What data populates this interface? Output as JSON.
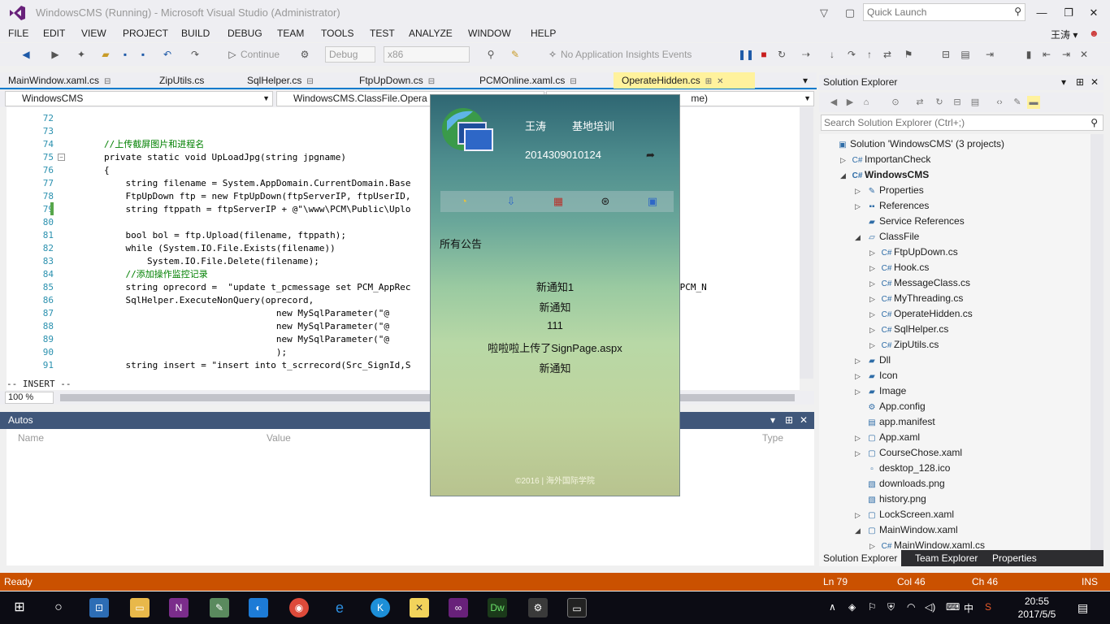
{
  "window": {
    "title": "WindowsCMS (Running) - Microsoft Visual Studio (Administrator)",
    "quick_launch_placeholder": "Quick Launch",
    "user": "王涛 ▾"
  },
  "menu": [
    "FILE",
    "EDIT",
    "VIEW",
    "PROJECT",
    "BUILD",
    "DEBUG",
    "TEAM",
    "TOOLS",
    "TEST",
    "ANALYZE",
    "WINDOW",
    "HELP"
  ],
  "toolbar": {
    "continue_label": "Continue",
    "config": "Debug",
    "platform": "x86",
    "insights": "No Application Insights Events"
  },
  "doc_tabs": [
    "MainWindow.xaml.cs",
    "ZipUtils.cs",
    "SqlHelper.cs",
    "FtpUpDown.cs",
    "PCMOnline.xaml.cs",
    "OperateHidden.cs"
  ],
  "nav": {
    "project": "WindowsCMS",
    "class": "WindowsCMS.ClassFile.Opera",
    "member": "me)"
  },
  "code": {
    "lines": [
      {
        "n": "72",
        "t": ""
      },
      {
        "n": "73",
        "t": ""
      },
      {
        "n": "74",
        "t": "//上传截屏图片和进程名"
      },
      {
        "n": "75",
        "t": "private static void UpLoadJpg(string jpgname)"
      },
      {
        "n": "76",
        "t": "{"
      },
      {
        "n": "77",
        "t": "    string filename = System.AppDomain.CurrentDomain.Base"
      },
      {
        "n": "78",
        "t": "    FtpUpDown ftp = new FtpUpDown(ftpServerIP, ftpUserID,"
      },
      {
        "n": "79",
        "t": "    string ftppath = ftpServerIP + @\"\\www\\PCM\\Public\\Uplo"
      },
      {
        "n": "80",
        "t": ""
      },
      {
        "n": "81",
        "t": "    bool bol = ftp.Upload(filename, ftppath);"
      },
      {
        "n": "82",
        "t": "    while (System.IO.File.Exists(filename))"
      },
      {
        "n": "83",
        "t": "        System.IO.File.Delete(filename);"
      },
      {
        "n": "84",
        "t": "    //添加操作监控记录"
      },
      {
        "n": "85",
        "t": "    string oprecord =  \"update t_pcmessage set PCM_AppRec                                  eenJpgsrc where PCM_N"
      },
      {
        "n": "86",
        "t": "    SqlHelper.ExecuteNonQuery(oprecord,"
      },
      {
        "n": "87",
        "t": "                                new MySqlParameter(\"@"
      },
      {
        "n": "88",
        "t": "                                new MySqlParameter(\"@"
      },
      {
        "n": "89",
        "t": "                                new MySqlParameter(\"@"
      },
      {
        "n": "90",
        "t": "                                );"
      },
      {
        "n": "91",
        "t": "    string insert = \"insert into t_scrrecord(Src_SignId,S                                          \";"
      }
    ],
    "insert_mode": "-- INSERT --",
    "zoom": "100 %"
  },
  "autos": {
    "title": "Autos",
    "col_name": "Name",
    "col_value": "Value",
    "col_type": "Type"
  },
  "solution_explorer": {
    "title": "Solution Explorer",
    "search_placeholder": "Search Solution Explorer (Ctrl+;)",
    "items": [
      {
        "label": "Solution 'WindowsCMS' (3 projects)",
        "icon": "solution-icon",
        "depth": 0,
        "exp": ""
      },
      {
        "label": "ImportanCheck",
        "icon": "csproj-icon",
        "depth": 1,
        "exp": "▷"
      },
      {
        "label": "WindowsCMS",
        "icon": "csproj-icon",
        "depth": 1,
        "exp": "◢",
        "bold": true
      },
      {
        "label": "Properties",
        "icon": "wrench-icon",
        "depth": 2,
        "exp": "▷"
      },
      {
        "label": "References",
        "icon": "references-icon",
        "depth": 2,
        "exp": "▷"
      },
      {
        "label": "Service References",
        "icon": "folder-icon",
        "depth": 2,
        "exp": ""
      },
      {
        "label": "ClassFile",
        "icon": "folder-open-icon",
        "depth": 2,
        "exp": "◢"
      },
      {
        "label": "FtpUpDown.cs",
        "icon": "cs-file-icon",
        "depth": 3,
        "exp": "▷"
      },
      {
        "label": "Hook.cs",
        "icon": "cs-file-icon",
        "depth": 3,
        "exp": "▷"
      },
      {
        "label": "MessageClass.cs",
        "icon": "cs-file-icon",
        "depth": 3,
        "exp": "▷"
      },
      {
        "label": "MyThreading.cs",
        "icon": "cs-file-icon",
        "depth": 3,
        "exp": "▷"
      },
      {
        "label": "OperateHidden.cs",
        "icon": "cs-file-icon",
        "depth": 3,
        "exp": "▷"
      },
      {
        "label": "SqlHelper.cs",
        "icon": "cs-file-icon",
        "depth": 3,
        "exp": "▷"
      },
      {
        "label": "ZipUtils.cs",
        "icon": "cs-file-icon",
        "depth": 3,
        "exp": "▷"
      },
      {
        "label": "Dll",
        "icon": "folder-icon",
        "depth": 2,
        "exp": "▷"
      },
      {
        "label": "Icon",
        "icon": "folder-icon",
        "depth": 2,
        "exp": "▷"
      },
      {
        "label": "Image",
        "icon": "folder-icon",
        "depth": 2,
        "exp": "▷"
      },
      {
        "label": "App.config",
        "icon": "config-file-icon",
        "depth": 2,
        "exp": ""
      },
      {
        "label": "app.manifest",
        "icon": "manifest-file-icon",
        "depth": 2,
        "exp": ""
      },
      {
        "label": "App.xaml",
        "icon": "xaml-file-icon",
        "depth": 2,
        "exp": "▷"
      },
      {
        "label": "CourseChose.xaml",
        "icon": "xaml-file-icon",
        "depth": 2,
        "exp": "▷"
      },
      {
        "label": "desktop_128.ico",
        "icon": "ico-file-icon",
        "depth": 2,
        "exp": ""
      },
      {
        "label": "downloads.png",
        "icon": "png-file-icon",
        "depth": 2,
        "exp": ""
      },
      {
        "label": "history.png",
        "icon": "png-file-icon",
        "depth": 2,
        "exp": ""
      },
      {
        "label": "LockScreen.xaml",
        "icon": "xaml-file-icon",
        "depth": 2,
        "exp": "▷"
      },
      {
        "label": "MainWindow.xaml",
        "icon": "xaml-file-icon",
        "depth": 2,
        "exp": "◢"
      },
      {
        "label": "MainWindow.xaml.cs",
        "icon": "cs-file-icon",
        "depth": 3,
        "exp": "▷"
      }
    ],
    "tabs": [
      "Solution Explorer",
      "Team Explorer",
      "Properties"
    ]
  },
  "status": {
    "state": "Ready",
    "ln": "Ln 79",
    "col": "Col 46",
    "ch": "Ch 46",
    "mode": "INS"
  },
  "widget": {
    "name": "王涛",
    "dept": "基地培训",
    "student_id": "2014309010124",
    "section_title": "所有公告",
    "notices": [
      "新通知1",
      "新通知",
      "111",
      "啦啦啦上传了SignPage.aspx",
      "新通知"
    ],
    "footer": "©2016 | 海外国际学院"
  },
  "taskbar": {
    "time": "20:55",
    "date": "2017/5/5",
    "ime": "中"
  },
  "colors": {
    "accent": "#007acc",
    "status_bar": "#ca5100",
    "active_tab": "#fff29d",
    "autos_header": "#40577a"
  }
}
